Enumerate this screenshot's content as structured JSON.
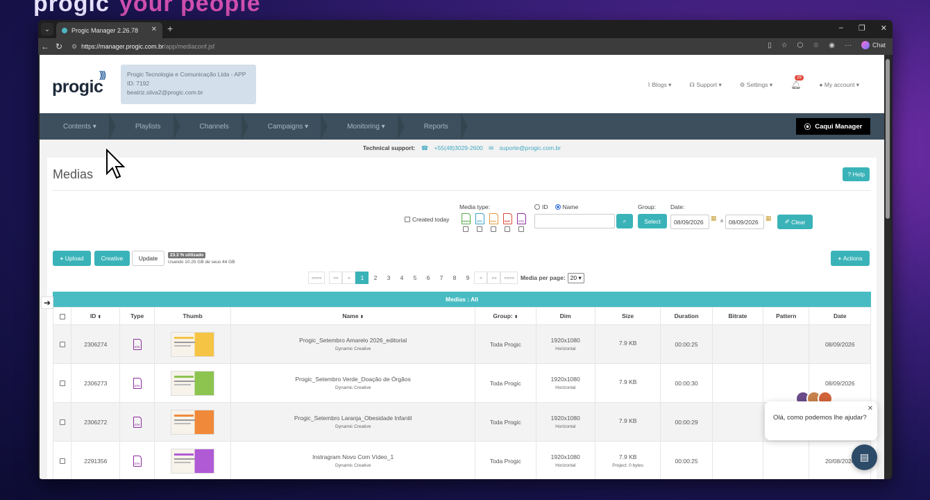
{
  "background": {
    "brand_left": "progic",
    "brand_right": "your people"
  },
  "browser": {
    "tab_title": "Progic Manager 2.26.78",
    "url_host": "https://manager.progic.com.br",
    "url_path": "/app/mediaconf.jsf",
    "chat_label": "Chat"
  },
  "header": {
    "logo": "progic",
    "company_name": "Progic Tecnologia e Comunicação Ltda - APP",
    "company_id": "ID: 7192",
    "company_email": "beatriz.silva2@progic.com.br",
    "nav": {
      "blogs": "Blogs",
      "support": "Support",
      "settings": "Settings",
      "notifications": "29",
      "account": "My account"
    }
  },
  "mainnav": {
    "items": [
      "Contents",
      "Playlists",
      "Channels",
      "Campaigns",
      "Monitoring",
      "Reports"
    ],
    "brand_button": "Caqui Manager"
  },
  "support": {
    "label": "Technical support:",
    "phone": "+55(48)3029-2600",
    "email": "suporte@progic.com.br"
  },
  "page": {
    "title": "Medias",
    "help": "Help",
    "filters": {
      "created_today": "Created today",
      "media_type_label": "Media type:",
      "media_types": [
        "VIDEO",
        "JPG",
        "PNG",
        "SWF",
        "CTV"
      ],
      "id_label": "ID",
      "name_label": "Name",
      "search_value": "",
      "group_label": "Group:",
      "select_button": "Select",
      "date_label": "Date:",
      "date_from": "08/09/2026",
      "date_sep": "a",
      "date_to": "08/09/2026",
      "clear_button": "Clear"
    },
    "toolbar": {
      "upload": "Upload",
      "creative": "Creative",
      "update": "Update",
      "usage_pill": "23.3 % utilizado",
      "usage_text": "Usando 10.25 GB de seus 44 GB",
      "actions": "Actions"
    },
    "pager": {
      "first": "««««",
      "prev2": "««",
      "prev": "«",
      "pages": [
        "1",
        "2",
        "3",
        "4",
        "5",
        "6",
        "7",
        "8",
        "9"
      ],
      "current": "1",
      "next": "»",
      "next2": "»»",
      "last": "»»»»",
      "per_page_label": "Media per page:",
      "per_page_value": "20"
    },
    "table": {
      "caption": "Medias : All",
      "columns": [
        "ID",
        "Type",
        "Thumb",
        "Name",
        "Group:",
        "Dim",
        "Size",
        "Duration",
        "Bitrate",
        "Pattern",
        "Date"
      ],
      "rows": [
        {
          "id": "2306274",
          "type": "CTV",
          "name": "Progic_Setembro Amarelo 2026_editorial",
          "sub": "Dynamic Creative",
          "group": "Toda Progic",
          "dim": "1920x1080",
          "orientation": "Horizontal",
          "size": "7.9 KB",
          "size_sub": "",
          "duration": "00:00:25",
          "bitrate": "",
          "pattern": "",
          "date": "08/09/2026",
          "thumb_color": "#f6c445"
        },
        {
          "id": "2306273",
          "type": "CTV",
          "name": "Progic_Setembro Verde_Doação de Órgãos",
          "sub": "Dynamic Creative",
          "group": "Toda Progic",
          "dim": "1920x1080",
          "orientation": "Horizontal",
          "size": "7.9 KB",
          "size_sub": "",
          "duration": "00:00:30",
          "bitrate": "",
          "pattern": "",
          "date": "08/09/2026",
          "thumb_color": "#8cc44f"
        },
        {
          "id": "2306272",
          "type": "CTV",
          "name": "Progic_Setembro Laranja_Obesidade Infantil",
          "sub": "Dynamic Creative",
          "group": "Toda Progic",
          "dim": "1920x1080",
          "orientation": "Horizontal",
          "size": "7.9 KB",
          "size_sub": "",
          "duration": "00:00:29",
          "bitrate": "",
          "pattern": "",
          "date": "08/09/2026",
          "thumb_color": "#f08a3a"
        },
        {
          "id": "2291356",
          "type": "CTV",
          "name": "Instragram Novo Com Vídeo_1",
          "sub": "Dynamic Creative",
          "group": "Toda Progic",
          "dim": "1920x1080",
          "orientation": "Horizontal",
          "size": "7.9 KB",
          "size_sub": "Project: 0 bytes",
          "duration": "00:00:25",
          "bitrate": "",
          "pattern": "",
          "date": "20/08/2026",
          "thumb_color": "#b05ad6"
        }
      ]
    }
  },
  "chat_widget": {
    "message": "Olá, como podemos lhe ajudar?"
  }
}
